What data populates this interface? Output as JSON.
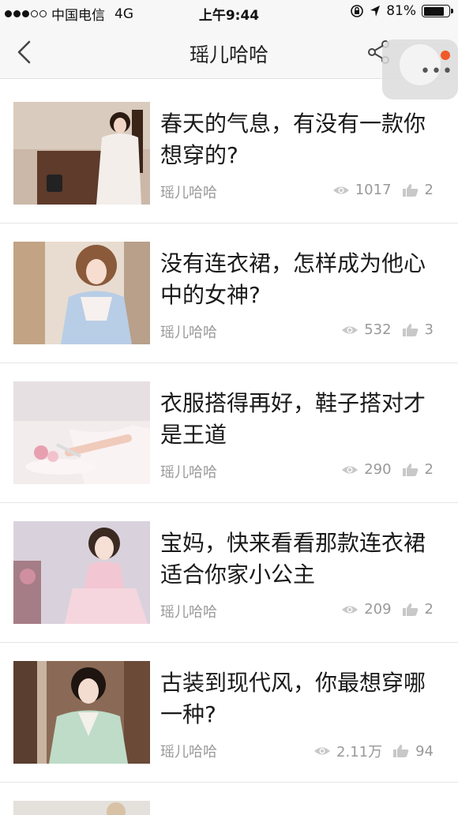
{
  "status_bar": {
    "carrier": "中国电信",
    "network": "4G",
    "time": "上午9:44",
    "battery": "81%",
    "battery_level": 0.81
  },
  "header": {
    "title": "瑶儿哈哈"
  },
  "articles": [
    {
      "title": "春天的气息，有没有一款你想穿的?",
      "author": "瑶儿哈哈",
      "views": "1017",
      "likes": "2"
    },
    {
      "title": "没有连衣裙，怎样成为他心中的女神?",
      "author": "瑶儿哈哈",
      "views": "532",
      "likes": "3"
    },
    {
      "title": "衣服搭得再好，鞋子搭对才是王道",
      "author": "瑶儿哈哈",
      "views": "290",
      "likes": "2"
    },
    {
      "title": "宝妈，快来看看那款连衣裙适合你家小公主",
      "author": "瑶儿哈哈",
      "views": "209",
      "likes": "2"
    },
    {
      "title": "古装到现代风，你最想穿哪一种?",
      "author": "瑶儿哈哈",
      "views": "2.11万",
      "likes": "94"
    }
  ],
  "icons": {
    "back": "chevron-left-icon",
    "share": "share-icon",
    "more": "more-icon",
    "views": "eye-icon",
    "likes": "thumbs-up-icon"
  },
  "colors": {
    "badge": "#f05a28",
    "meta_text": "#999999"
  }
}
